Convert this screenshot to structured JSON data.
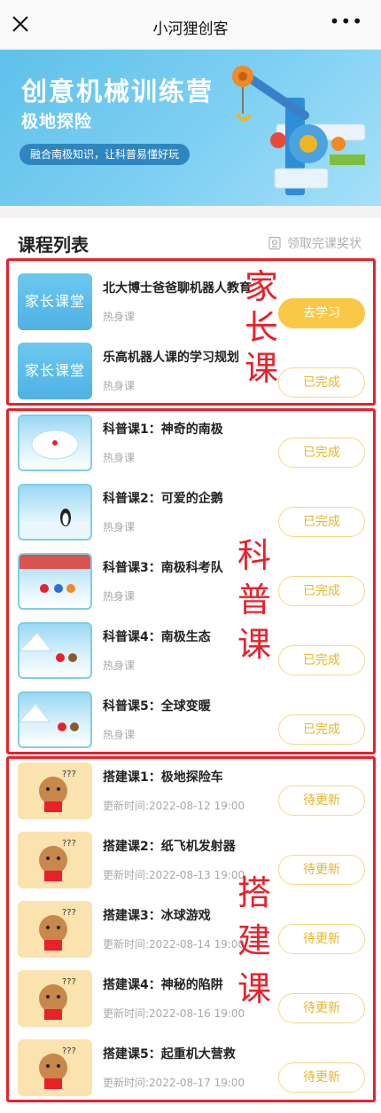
{
  "topbar": {
    "title": "小河狸创客",
    "close_icon": "close-icon",
    "more_label": "•••"
  },
  "banner": {
    "title": "创意机械训练营",
    "subtitle": "极地探险",
    "pill": "融合南极知识，让科普易懂好玩"
  },
  "section": {
    "title": "课程列表",
    "award_label": "领取完课奖状"
  },
  "groups": {
    "parent": {
      "tag": [
        "家",
        "长",
        "课"
      ]
    },
    "science": {
      "tag": [
        "科",
        "普",
        "课"
      ]
    },
    "build": {
      "tag": [
        "搭",
        "建",
        "课"
      ]
    }
  },
  "parent_items": [
    {
      "thumb": "家长课堂",
      "title": "北大博士爸爸聊机器人教育",
      "sub": "热身课",
      "button": "去学习"
    },
    {
      "thumb": "家长课堂",
      "title": "乐高机器人课的学习规划",
      "sub": "热身课",
      "button": "已完成"
    }
  ],
  "science_items": [
    {
      "title": "科普课1：神奇的南极",
      "sub": "热身课",
      "button": "已完成"
    },
    {
      "title": "科普课2：可爱的企鹅",
      "sub": "热身课",
      "button": "已完成"
    },
    {
      "title": "科普课3：南极科考队",
      "sub": "热身课",
      "button": "已完成"
    },
    {
      "title": "科普课4：南极生态",
      "sub": "热身课",
      "button": "已完成"
    },
    {
      "title": "科普课5：全球变暖",
      "sub": "热身课",
      "button": "已完成"
    }
  ],
  "build_items": [
    {
      "title": "搭建课1：极地探险车",
      "sub": "更新时间:2022-08-12 19:00",
      "button": "待更新"
    },
    {
      "title": "搭建课2：纸飞机发射器",
      "sub": "更新时间:2022-08-13 19:00",
      "button": "待更新"
    },
    {
      "title": "搭建课3：冰球游戏",
      "sub": "更新时间:2022-08-14 19:00",
      "button": "待更新"
    },
    {
      "title": "搭建课4：神秘的陷阱",
      "sub": "更新时间:2022-08-16 19:00",
      "button": "待更新"
    },
    {
      "title": "搭建课5：起重机大营救",
      "sub": "更新时间:2022-08-17 19:00",
      "button": "待更新"
    }
  ],
  "colors": {
    "accent": "#f9c847",
    "annotation": "#e8212b",
    "banner": "#6cc8ef"
  }
}
